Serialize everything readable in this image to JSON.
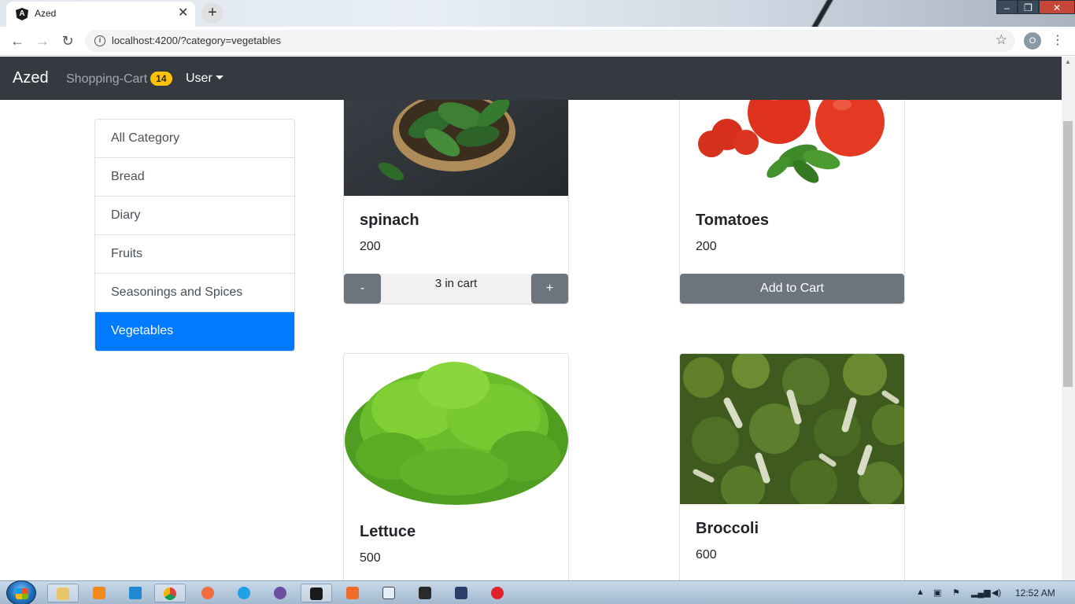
{
  "browser": {
    "tab_title": "Azed",
    "favicon_letter": "A",
    "url": "localhost:4200/?category=vegetables",
    "profile_initial": "O"
  },
  "navbar": {
    "brand": "Azed",
    "cart_label": "Shopping-Cart",
    "cart_count": "14",
    "user_label": "User"
  },
  "categories": [
    {
      "label": "All Category"
    },
    {
      "label": "Bread"
    },
    {
      "label": "Diary"
    },
    {
      "label": "Fruits"
    },
    {
      "label": "Seasonings and Spices"
    },
    {
      "label": "Vegetables",
      "active": true
    }
  ],
  "products": [
    {
      "title": "spinach",
      "price": "200",
      "in_cart_label": "3 in cart",
      "minus": "-",
      "plus": "+"
    },
    {
      "title": "Tomatoes",
      "price": "200",
      "add_label": "Add to Cart"
    },
    {
      "title": "Lettuce",
      "price": "500"
    },
    {
      "title": "Broccoli",
      "price": "600"
    }
  ],
  "taskbar": {
    "clock": "12:52 AM"
  },
  "colors": {
    "navbar": "#343a40",
    "active_category": "#007bff",
    "badge": "#ffc107",
    "button_secondary": "#6c757d"
  }
}
